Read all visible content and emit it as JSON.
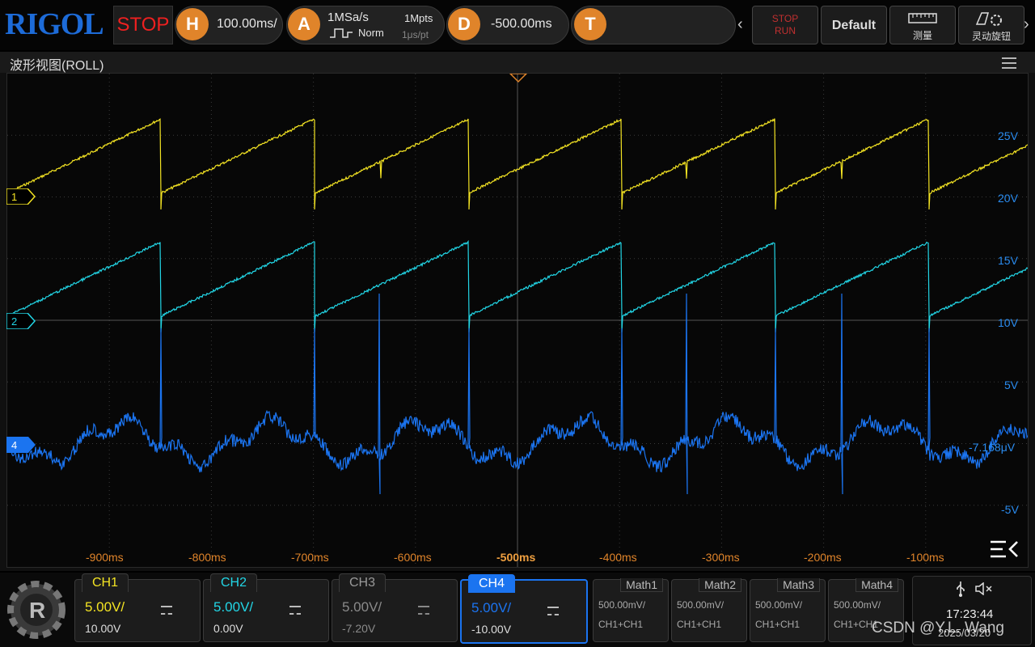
{
  "brand": "RIGOL",
  "run_state": "STOP",
  "horizontal": {
    "key": "H",
    "timebase": "100.00ms/"
  },
  "acquire": {
    "key": "A",
    "sample_rate": "1MSa/s",
    "depth": "1Mpts",
    "mode": "Norm",
    "resolution": "1μs/pt"
  },
  "delay": {
    "key": "D",
    "value": "-500.00ms"
  },
  "trigger": {
    "key": "T"
  },
  "toolbar": {
    "stop_label": "STOP",
    "run_label": "RUN",
    "default_label": "Default",
    "measure_label": "测量",
    "knob_label": "灵动旋钮"
  },
  "panel": {
    "title": "波形视图(ROLL)"
  },
  "channel_markers": {
    "ch1": "1",
    "ch2": "2",
    "ch4": "4"
  },
  "right_scale": [
    "25V",
    "20V",
    "15V",
    "10V",
    "5V",
    "-7.168μV",
    "-5V"
  ],
  "time_labels": [
    "-900ms",
    "-800ms",
    "-700ms",
    "-600ms",
    "-500ms",
    "-400ms",
    "-300ms",
    "-200ms",
    "-100ms"
  ],
  "channels": [
    {
      "name": "CH1",
      "scale": "5.00V/",
      "offset": "10.00V",
      "color": "#f4e423"
    },
    {
      "name": "CH2",
      "scale": "5.00V/",
      "offset": "0.00V",
      "color": "#22d6e6"
    },
    {
      "name": "CH3",
      "scale": "5.00V/",
      "offset": "-7.20V",
      "color": "#8a8a8a"
    },
    {
      "name": "CH4",
      "scale": "5.00V/",
      "offset": "-10.00V",
      "color": "#1b74f0"
    }
  ],
  "math": [
    {
      "name": "Math1",
      "scale": "500.00mV/",
      "source": "CH1+CH1"
    },
    {
      "name": "Math2",
      "scale": "500.00mV/",
      "source": "CH1+CH1"
    },
    {
      "name": "Math3",
      "scale": "500.00mV/",
      "source": "CH1+CH1"
    },
    {
      "name": "Math4",
      "scale": "500.00mV/",
      "source": "CH1+CH1"
    }
  ],
  "status": {
    "time": "17:23:44",
    "date": "2025/03/20",
    "usb_icon": "usb-icon",
    "sound_icon": "mute-icon"
  },
  "watermark": "CSDN @Y.L. Wang"
}
